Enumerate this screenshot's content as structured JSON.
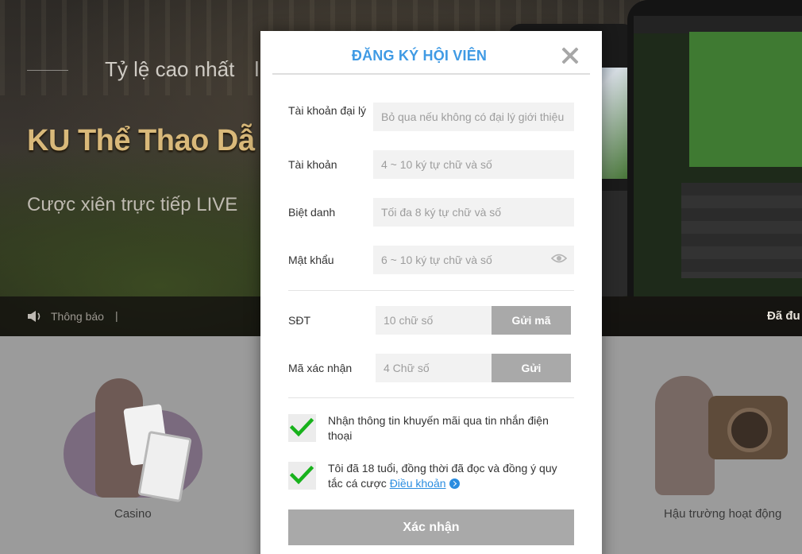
{
  "background": {
    "hero": {
      "tagline": "Tỷ lệ cao nhất",
      "tagline_extra": "l",
      "title": "KU Thể Thao Dẫ",
      "subtitle": "Cược xiên trực tiếp  LIVE"
    },
    "notice": {
      "label": "Thông báo",
      "separator": "|",
      "right_text": "Đã đu"
    },
    "categories": [
      {
        "label": "Casino"
      },
      {
        "label": "Hậu trường hoạt động"
      }
    ]
  },
  "modal": {
    "title": "ĐĂNG KÝ HỘI VIÊN",
    "fields": {
      "agent": {
        "label": "Tài khoản đại lý",
        "placeholder": "Bỏ qua nếu không có đại lý giới thiệu"
      },
      "account": {
        "label": "Tài khoản",
        "placeholder": "4 ~ 10 ký tự chữ và số"
      },
      "nickname": {
        "label": "Biệt danh",
        "placeholder": "Tối đa 8 ký tự chữ và số"
      },
      "password": {
        "label": "Mật khẩu",
        "placeholder": "6 ~ 10 ký tự chữ và số"
      },
      "phone": {
        "label": "SĐT",
        "placeholder": "10 chữ số",
        "button": "Gửi mã"
      },
      "code": {
        "label": "Mã xác nhận",
        "placeholder": "4 Chữ số",
        "button": "Gửi"
      }
    },
    "checkboxes": {
      "promo": {
        "text": "Nhận thông tin khuyến mãi qua tin nhắn điện thoại",
        "checked": true
      },
      "terms": {
        "text": "Tôi đã 18 tuổi, đồng thời đã đọc và đồng ý quy tắc cá cược ",
        "link": "Điều khoản",
        "checked": true
      }
    },
    "submit": "Xác nhận"
  },
  "colors": {
    "title_blue": "#3f9ae4",
    "check_green": "#18b21c",
    "button_gray": "#a9a9a9",
    "link_blue": "#2b8de0"
  }
}
